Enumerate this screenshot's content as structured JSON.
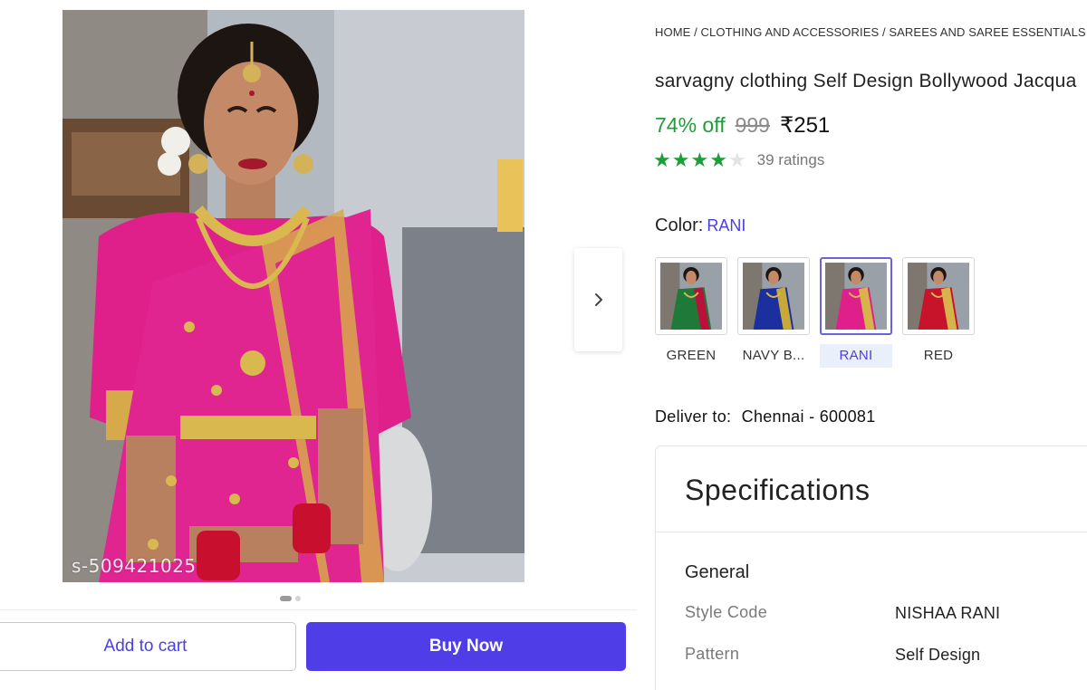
{
  "product": {
    "breadcrumb": "HOME / CLOTHING AND ACCESSORIES / SAREES AND SAREE ESSENTIALS /",
    "title": "sarvagny clothing Self Design Bollywood Jacqua",
    "discount": "74% off",
    "mrp": "999",
    "price": "₹251",
    "rating": {
      "stars_filled": 4,
      "stars_total": 5,
      "count_label": "39 ratings"
    },
    "image_watermark": "s-509421025",
    "carousel": {
      "active_index": 0,
      "count": 2
    }
  },
  "color": {
    "label": "Color:",
    "selected": "RANI",
    "options": [
      {
        "label": "GREEN",
        "saree_color": "#1f7a3a",
        "border_color": "#b8123a"
      },
      {
        "label": "NAVY B...",
        "saree_color": "#1c2f9e",
        "border_color": "#c9a83a"
      },
      {
        "label": "RANI",
        "saree_color": "#e0208a",
        "border_color": "#d8b24a"
      },
      {
        "label": "RED",
        "saree_color": "#c8142a",
        "border_color": "#d8b24a"
      }
    ]
  },
  "delivery": {
    "label": "Deliver to:",
    "location": "Chennai - 600081"
  },
  "actions": {
    "add_to_cart": "Add to cart",
    "buy_now": "Buy Now"
  },
  "specifications": {
    "title": "Specifications",
    "section": "General",
    "rows": [
      {
        "key": "Style Code",
        "value": "NISHAA RANI"
      },
      {
        "key": "Pattern",
        "value": "Self Design"
      }
    ]
  },
  "colors": {
    "accent": "#4f3ee8",
    "discount_green": "#1f9d3a",
    "rating_green": "#1f9d3a",
    "selected_bg": "#e9effb"
  }
}
